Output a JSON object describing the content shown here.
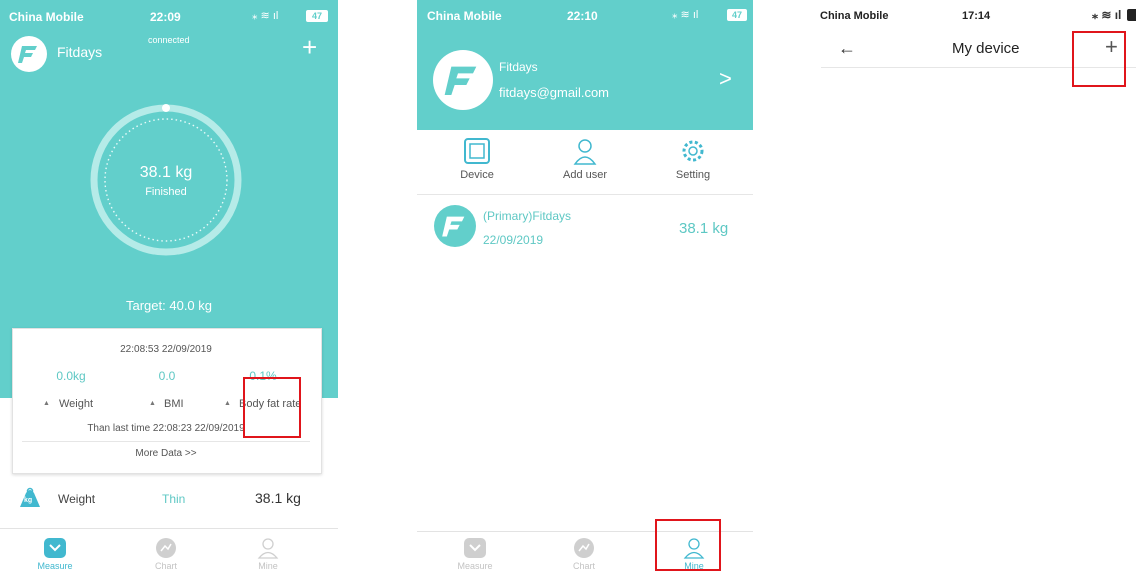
{
  "screen1": {
    "status": {
      "carrier": "China Mobile",
      "time": "22:09",
      "battery": "47"
    },
    "header": {
      "app_name": "Fitdays",
      "connection": "connected",
      "add_symbol": "+"
    },
    "ring": {
      "weight": "38.1 kg",
      "state": "Finished"
    },
    "target": "Target: 40.0 kg",
    "card": {
      "timestamp": "22:08:53 22/09/2019",
      "stats": [
        {
          "value": "0.0kg",
          "label": "Weight"
        },
        {
          "value": "0.0",
          "label": "BMI"
        },
        {
          "value": "0.1%",
          "label": "Body fat rate"
        }
      ],
      "compare": "Than last time 22:08:23 22/09/2019",
      "more": "More Data >>"
    },
    "weight_row": {
      "icon_text": "kg",
      "label": "Weight",
      "status": "Thin",
      "value": "38.1 kg"
    },
    "tabs": [
      "Measure",
      "Chart",
      "Mine"
    ]
  },
  "screen2": {
    "status": {
      "carrier": "China Mobile",
      "time": "22:10",
      "battery": "47"
    },
    "profile": {
      "name": "Fitdays",
      "email": "fitdays@gmail.com",
      "chevron": ">"
    },
    "actions": [
      "Device",
      "Add user",
      "Setting"
    ],
    "user": {
      "name": "(Primary)Fitdays",
      "date": "22/09/2019",
      "weight": "38.1 kg"
    },
    "tabs": [
      "Measure",
      "Chart",
      "Mine"
    ]
  },
  "screen3": {
    "status": {
      "carrier": "China Mobile",
      "time": "17:14"
    },
    "nav": {
      "back": "←",
      "title": "My device",
      "add": "+"
    }
  },
  "colors": {
    "teal": "#62cfcb",
    "highlight": "#e0151b"
  }
}
